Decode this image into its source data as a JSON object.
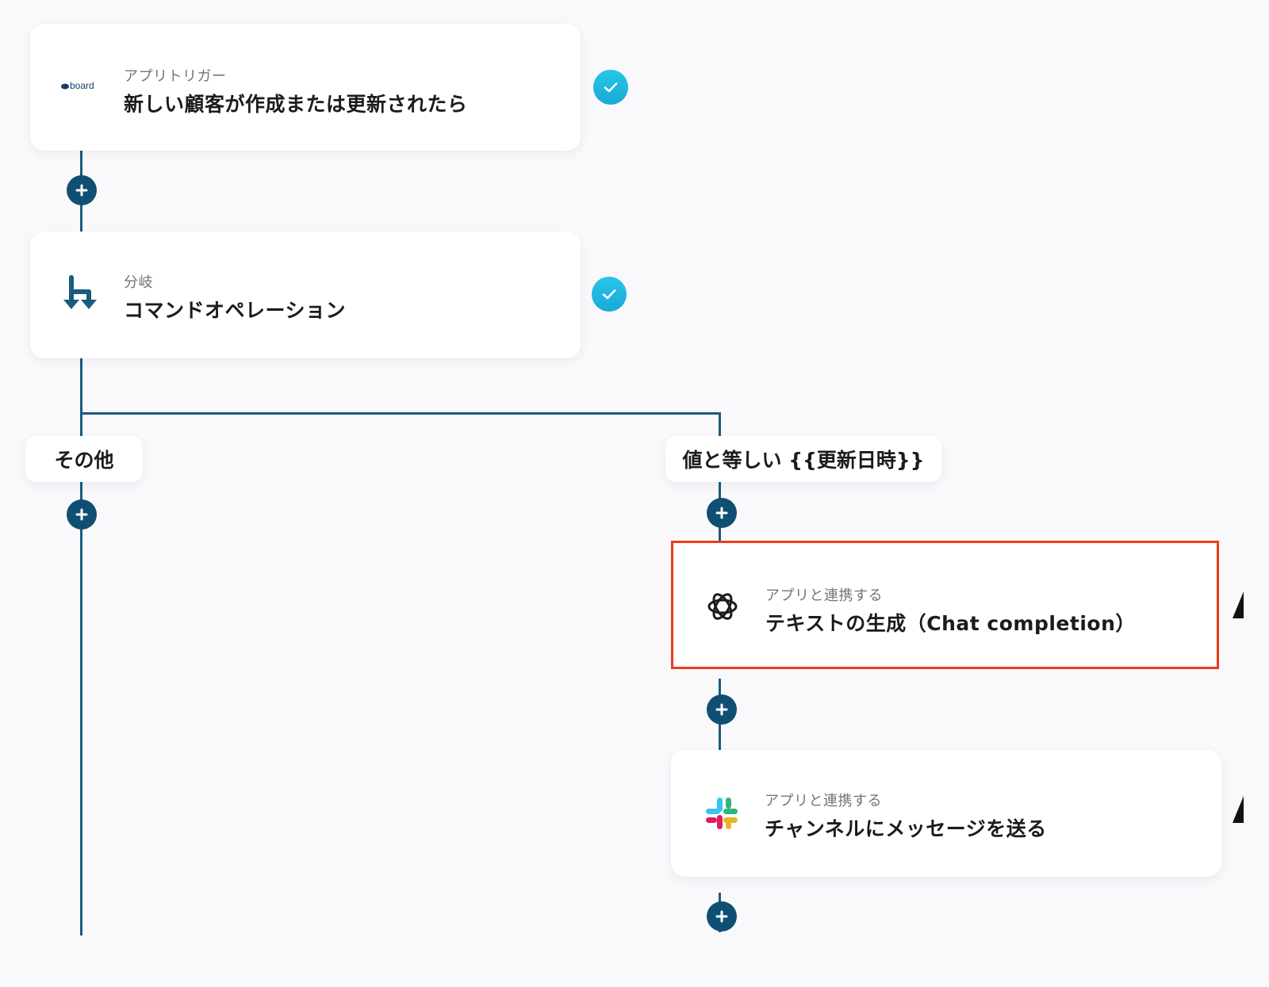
{
  "flow": {
    "trigger": {
      "app_icon": "board-logo",
      "app_logo_text": "board",
      "subtitle": "アプリトリガー",
      "title": "新しい顧客が作成または更新されたら",
      "status_icon": "check-icon"
    },
    "branch": {
      "app_icon": "branch-icon",
      "subtitle": "分岐",
      "title": "コマンドオペレーション",
      "status_icon": "check-icon"
    },
    "branches": [
      {
        "label": "その他"
      },
      {
        "label": "値と等しい {{更新日時}}"
      }
    ],
    "chat_step": {
      "app_icon": "openai-icon",
      "subtitle": "アプリと連携する",
      "title": "テキストの生成（Chat completion）"
    },
    "slack_step": {
      "app_icon": "slack-icon",
      "subtitle": "アプリと連携する",
      "title": "チャンネルにメッセージを送る"
    },
    "add_button_icon": "plus-icon"
  },
  "colors": {
    "connector": "#1a5b80",
    "add_button": "#0f4f72",
    "check_badge": "#27c6ea",
    "highlight_border": "#ef3a1d",
    "background": "#f9f8fb"
  }
}
